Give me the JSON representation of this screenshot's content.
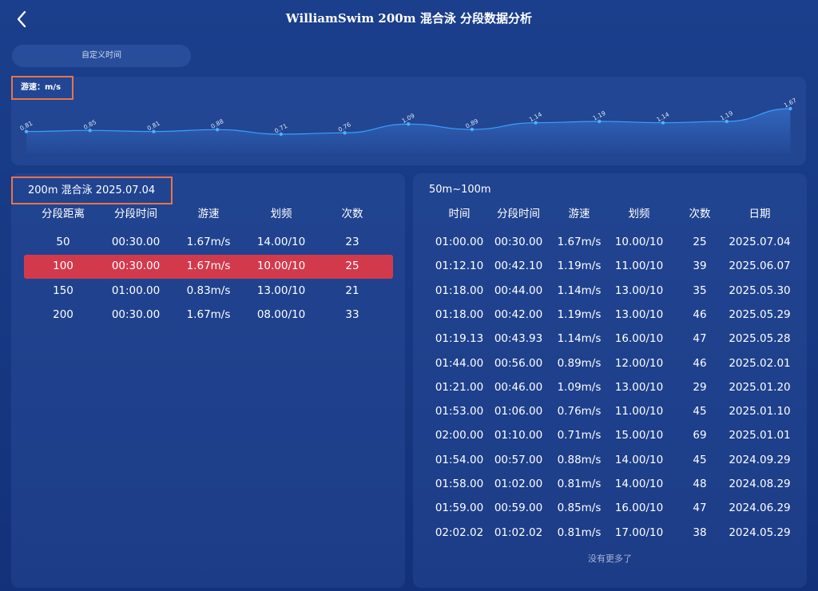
{
  "header": {
    "title": "WilliamSwim 200m 混合泳 分段数据分析"
  },
  "filter": {
    "custom_time_label": "自定义时间"
  },
  "chart_data": {
    "type": "line",
    "ylabel": "游速：m/s",
    "values": [
      0.81,
      0.85,
      0.81,
      0.88,
      0.71,
      0.76,
      1.09,
      0.89,
      1.14,
      1.19,
      1.14,
      1.19,
      1.67
    ],
    "labels": [
      "0.81",
      "0.85",
      "0.81",
      "0.88",
      "0.71",
      "0.76",
      "1.09",
      "0.89",
      "1.14",
      "1.19",
      "1.14",
      "1.19",
      "1.67"
    ],
    "colors": {
      "line": "#3aa0ff",
      "point": "#4fb0ff",
      "fill": "#3f7fe0"
    }
  },
  "left_table": {
    "title": "200m 混合泳 2025.07.04",
    "headers": [
      "分段距离",
      "分段时间",
      "游速",
      "划频",
      "次数"
    ],
    "rows": [
      [
        "50",
        "00:30.00",
        "1.67m/s",
        "14.00/10",
        "23"
      ],
      [
        "100",
        "00:30.00",
        "1.67m/s",
        "10.00/10",
        "25"
      ],
      [
        "150",
        "01:00.00",
        "0.83m/s",
        "13.00/10",
        "21"
      ],
      [
        "200",
        "00:30.00",
        "1.67m/s",
        "08.00/10",
        "33"
      ]
    ],
    "highlight_color": "#d23a4c"
  },
  "right_table": {
    "title": "50m~100m",
    "headers": [
      "时间",
      "分段时间",
      "游速",
      "划频",
      "次数",
      "日期"
    ],
    "rows": [
      [
        "01:00.00",
        "00:30.00",
        "1.67m/s",
        "10.00/10",
        "25",
        "2025.07.04"
      ],
      [
        "01:12.10",
        "00:42.10",
        "1.19m/s",
        "11.00/10",
        "39",
        "2025.06.07"
      ],
      [
        "01:18.00",
        "00:44.00",
        "1.14m/s",
        "13.00/10",
        "35",
        "2025.05.30"
      ],
      [
        "01:18.00",
        "00:42.00",
        "1.19m/s",
        "13.00/10",
        "46",
        "2025.05.29"
      ],
      [
        "01:19.13",
        "00:43.93",
        "1.14m/s",
        "16.00/10",
        "47",
        "2025.05.28"
      ],
      [
        "01:44.00",
        "00:56.00",
        "0.89m/s",
        "12.00/10",
        "46",
        "2025.02.01"
      ],
      [
        "01:21.00",
        "00:46.00",
        "1.09m/s",
        "13.00/10",
        "29",
        "2025.01.20"
      ],
      [
        "01:53.00",
        "01:06.00",
        "0.76m/s",
        "11.00/10",
        "45",
        "2025.01.10"
      ],
      [
        "02:00.00",
        "01:10.00",
        "0.71m/s",
        "15.00/10",
        "69",
        "2025.01.01"
      ],
      [
        "01:54.00",
        "00:57.00",
        "0.88m/s",
        "14.00/10",
        "45",
        "2024.09.29"
      ],
      [
        "01:58.00",
        "01:02.00",
        "0.81m/s",
        "14.00/10",
        "48",
        "2024.08.29"
      ],
      [
        "01:59.00",
        "00:59.00",
        "0.85m/s",
        "16.00/10",
        "47",
        "2024.06.29"
      ],
      [
        "02:02.02",
        "01:02.02",
        "0.81m/s",
        "17.00/10",
        "38",
        "2024.05.29"
      ]
    ],
    "footer": "没有更多了"
  }
}
